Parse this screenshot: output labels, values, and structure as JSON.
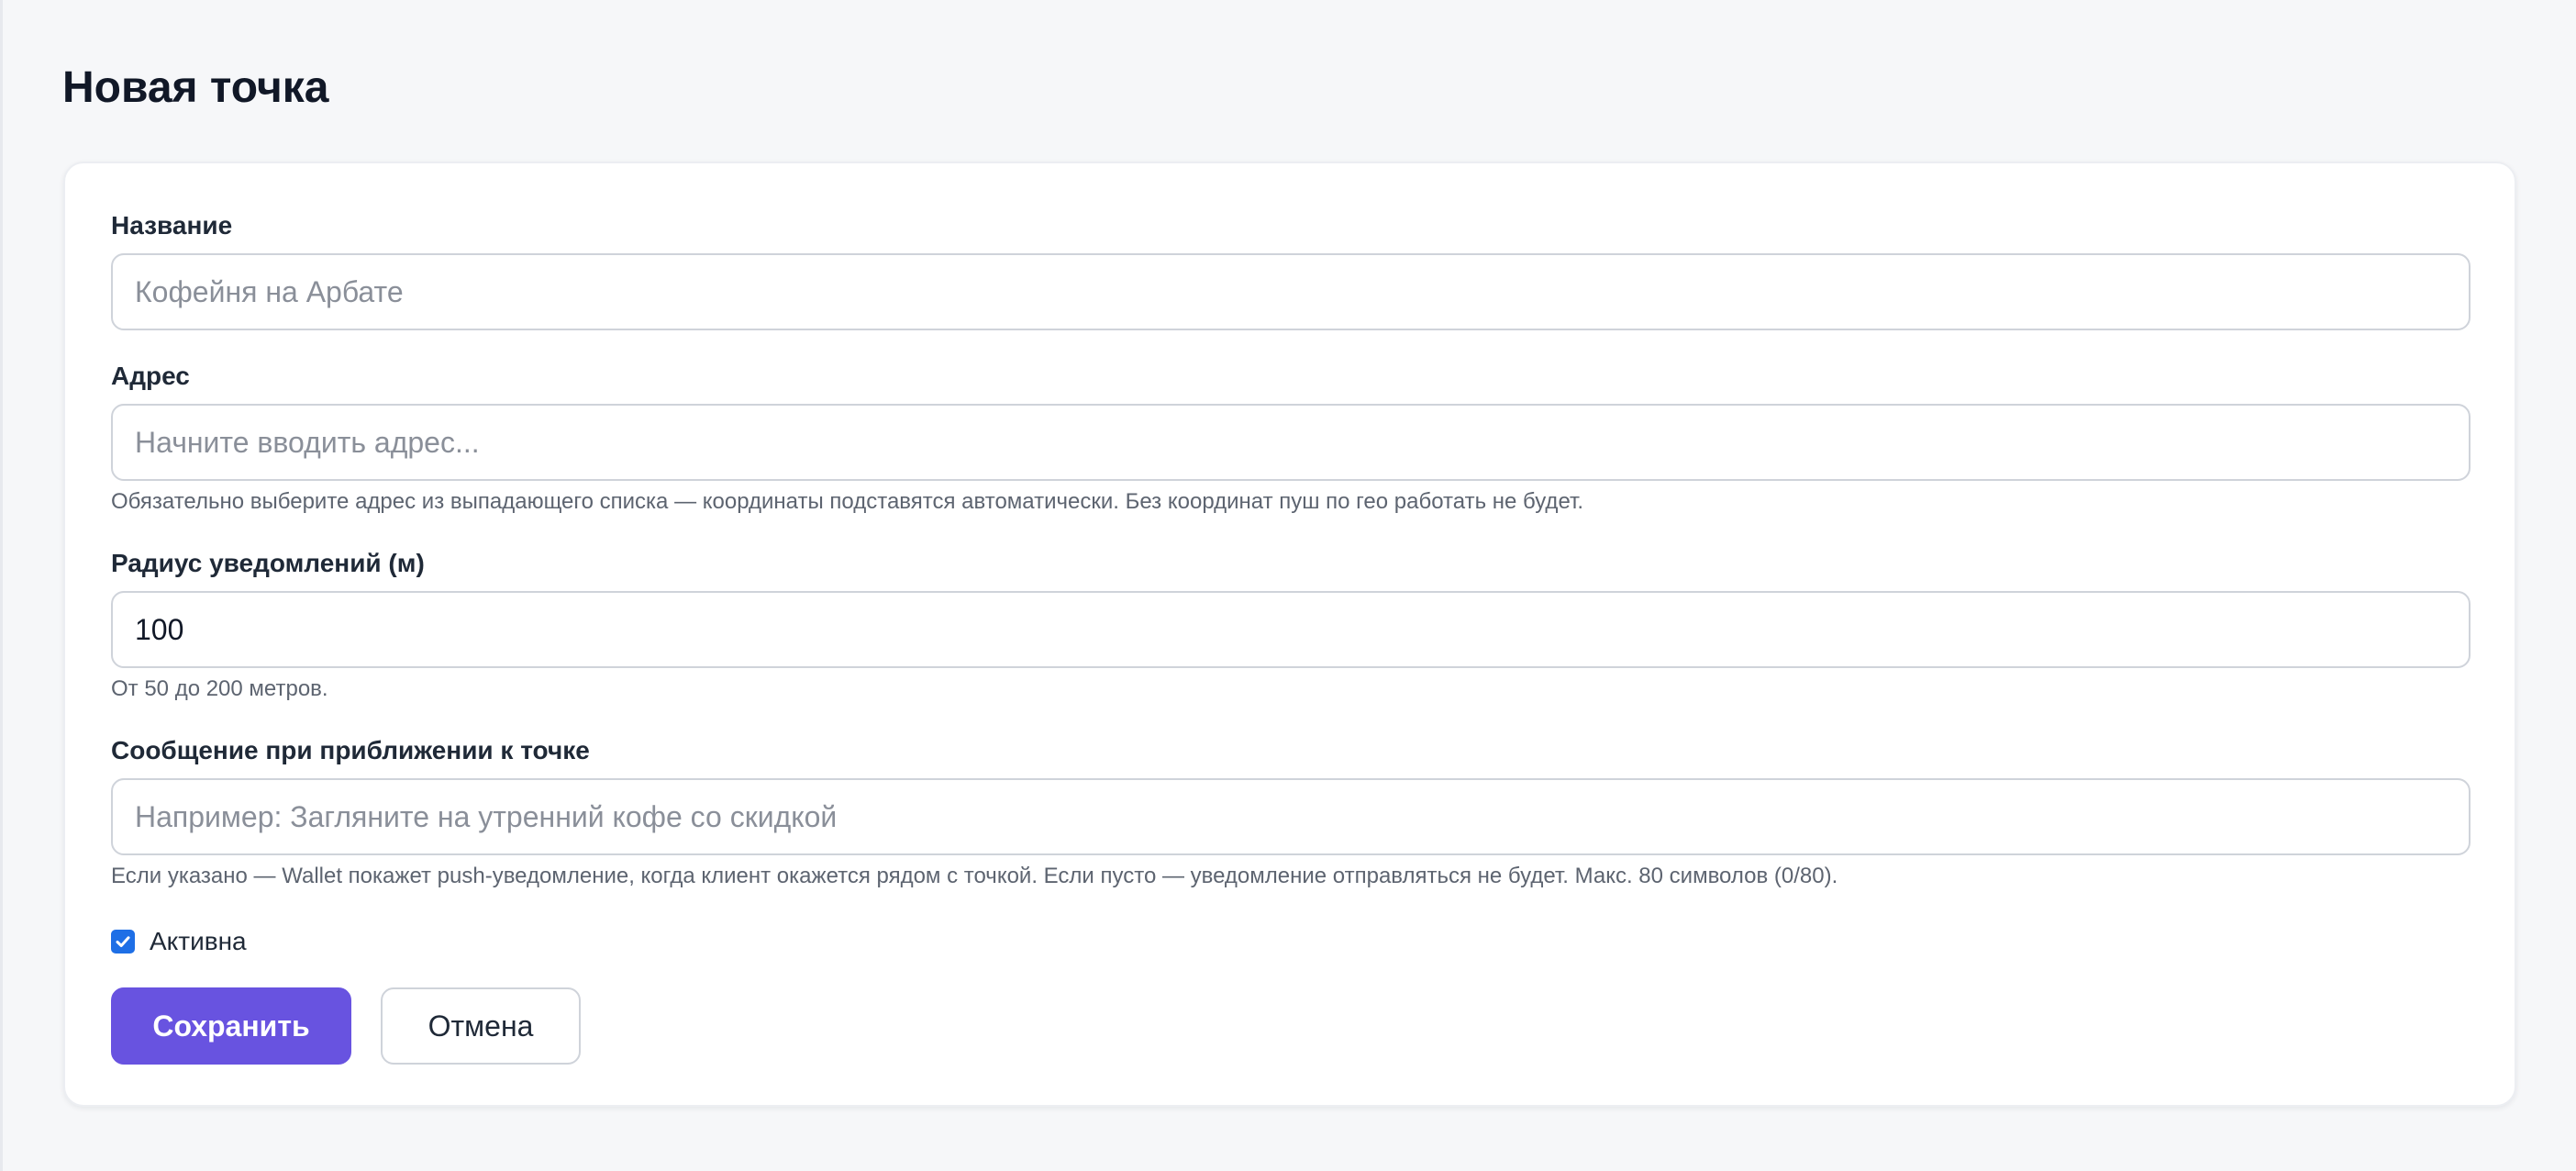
{
  "page": {
    "title": "Новая точка"
  },
  "form": {
    "name": {
      "label": "Название",
      "value": "",
      "placeholder": "Кофейня на Арбате"
    },
    "address": {
      "label": "Адрес",
      "value": "",
      "placeholder": "Начните вводить адрес...",
      "hint": "Обязательно выберите адрес из выпадающего списка — координаты подставятся автоматически. Без координат пуш по гео работать не будет."
    },
    "radius": {
      "label": "Радиус уведомлений (м)",
      "value": "100",
      "placeholder": "",
      "hint": "От 50 до 200 метров."
    },
    "message": {
      "label": "Сообщение при приближении к точке",
      "value": "",
      "placeholder": "Например: Загляните на утренний кофе со скидкой",
      "hint": "Если указано — Wallet покажет push-уведомление, когда клиент окажется рядом с точкой. Если пусто — уведомление отправляться не будет. Макс. 80 символов (0/80)."
    },
    "active": {
      "label": "Активна",
      "checked": true
    }
  },
  "actions": {
    "save_label": "Сохранить",
    "cancel_label": "Отмена"
  },
  "colors": {
    "accent": "#6853e0",
    "checkbox": "#1e6fe6",
    "background": "#f6f7f9"
  }
}
